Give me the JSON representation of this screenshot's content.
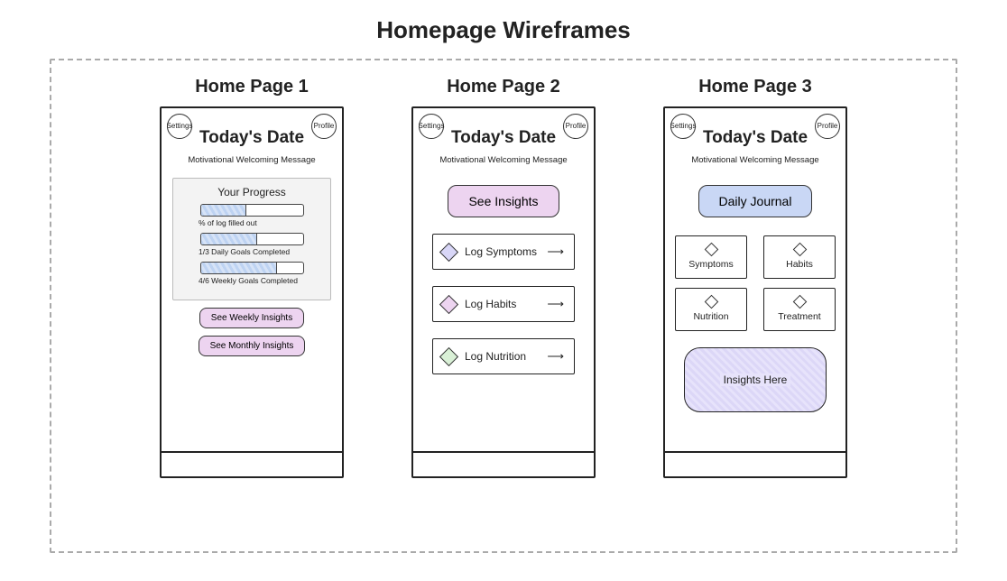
{
  "title": "Homepage Wireframes",
  "columns": [
    {
      "label": "Home Page 1"
    },
    {
      "label": "Home Page 2"
    },
    {
      "label": "Home Page 3"
    }
  ],
  "shared": {
    "settings": "Settings",
    "profile": "Profile",
    "date": "Today's Date",
    "welcome": "Motivational Welcoming Message"
  },
  "page1": {
    "progress_title": "Your Progress",
    "bars": [
      {
        "label": "% of log filled out",
        "pct": 45
      },
      {
        "label": "1/3 Daily Goals Completed",
        "pct": 55
      },
      {
        "label": "4/6 Weekly Goals Completed",
        "pct": 75
      }
    ],
    "weekly_btn": "See Weekly Insights",
    "monthly_btn": "See Monthly Insights"
  },
  "page2": {
    "insights_btn": "See Insights",
    "logs": [
      {
        "label": "Log Symptoms"
      },
      {
        "label": "Log Habits"
      },
      {
        "label": "Log Nutrition"
      }
    ]
  },
  "page3": {
    "journal_btn": "Daily Journal",
    "tiles": [
      {
        "label": "Symptoms"
      },
      {
        "label": "Habits"
      },
      {
        "label": "Nutrition"
      },
      {
        "label": "Treatment"
      }
    ],
    "insights_box": "Insights Here"
  }
}
